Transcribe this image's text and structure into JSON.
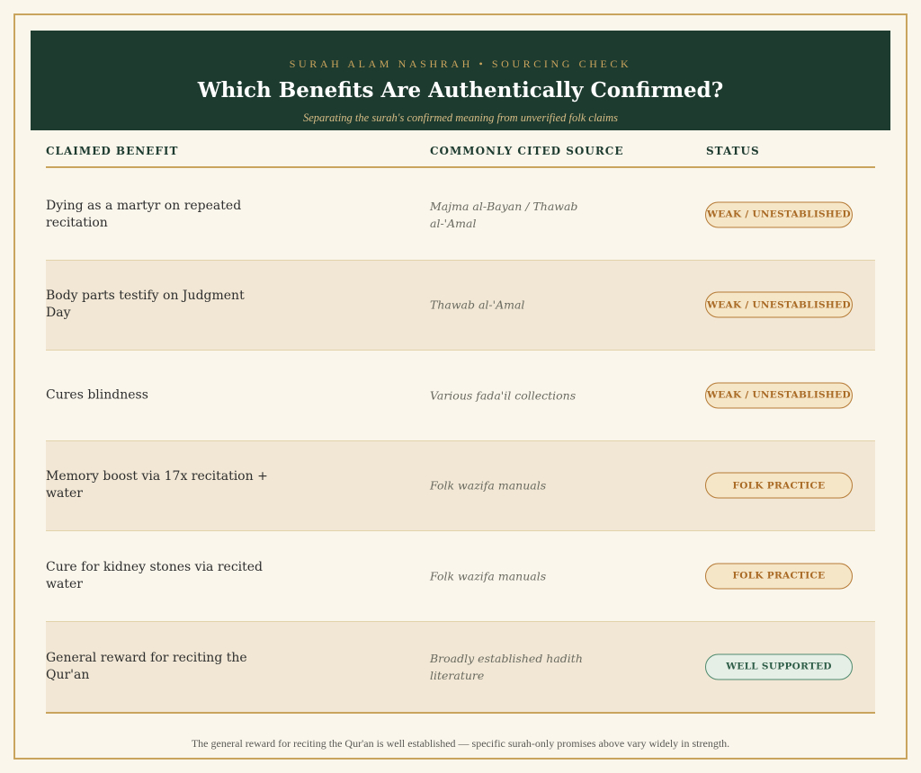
{
  "header": {
    "kicker": "SURAH ALAM NASHRAH • SOURCING CHECK",
    "title": "Which Benefits Are Authentically Confirmed?",
    "subtitle": "Separating the surah's confirmed meaning from unverified folk claims"
  },
  "table": {
    "columns": [
      "CLAIMED BENEFIT",
      "COMMONLY CITED SOURCE",
      "STATUS"
    ],
    "rows": [
      {
        "benefit": "Dying as a martyr on repeated recitation",
        "source": "Majma al-Bayan / Thawab al-'Amal",
        "status": "WEAK / UNESTABLISHED",
        "status_kind": "weak"
      },
      {
        "benefit": "Body parts testify on Judgment Day",
        "source": "Thawab al-'Amal",
        "status": "WEAK / UNESTABLISHED",
        "status_kind": "weak"
      },
      {
        "benefit": "Cures blindness",
        "source": "Various fada'il collections",
        "status": "WEAK / UNESTABLISHED",
        "status_kind": "weak"
      },
      {
        "benefit": "Memory boost via 17x recitation + water",
        "source": "Folk wazifa manuals",
        "status": "FOLK PRACTICE",
        "status_kind": "folk"
      },
      {
        "benefit": "Cure for kidney stones via recited water",
        "source": "Folk wazifa manuals",
        "status": "FOLK PRACTICE",
        "status_kind": "folk"
      },
      {
        "benefit": "General reward for reciting the Qur'an",
        "source": "Broadly established hadith literature",
        "status": "WELL SUPPORTED",
        "status_kind": "good"
      }
    ]
  },
  "footer": "The general reward for reciting the Qur'an is well established — specific surah-only promises above vary widely in strength.",
  "colors": {
    "header_bg": "#1e3b30",
    "gold": "#c9a45c",
    "weak_text": "#a86a25",
    "good_text": "#2f5e48"
  }
}
